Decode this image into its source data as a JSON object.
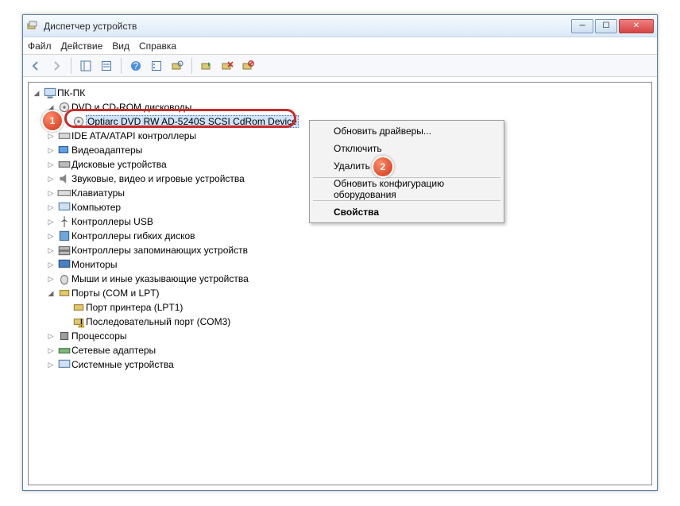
{
  "window": {
    "title": "Диспетчер устройств"
  },
  "menu": {
    "file": "Файл",
    "action": "Действие",
    "view": "Вид",
    "help": "Справка"
  },
  "tree": {
    "root": "ПК-ПК",
    "dvd_group": "DVD и CD-ROM дисководы",
    "dvd_device": "Optiarc DVD RW AD-5240S SCSI CdRom Device",
    "ide": "IDE ATA/ATAPI контроллеры",
    "video": "Видеоадаптеры",
    "disks": "Дисковые устройства",
    "audio": "Звуковые, видео и игровые устройства",
    "keyboards": "Клавиатуры",
    "computer": "Компьютер",
    "usb": "Контроллеры USB",
    "floppy": "Контроллеры гибких дисков",
    "storage": "Контроллеры запоминающих устройств",
    "monitors": "Мониторы",
    "mice": "Мыши и иные указывающие устройства",
    "ports": "Порты (COM и LPT)",
    "printer_port": "Порт принтера (LPT1)",
    "serial_port": "Последовательный порт (COM3)",
    "cpu": "Процессоры",
    "net": "Сетевые адаптеры",
    "sys": "Системные устройства"
  },
  "context": {
    "update": "Обновить драйверы...",
    "disable": "Отключить",
    "delete": "Удалить",
    "rescan": "Обновить конфигурацию оборудования",
    "props": "Свойства"
  },
  "badges": {
    "one": "1",
    "two": "2"
  }
}
